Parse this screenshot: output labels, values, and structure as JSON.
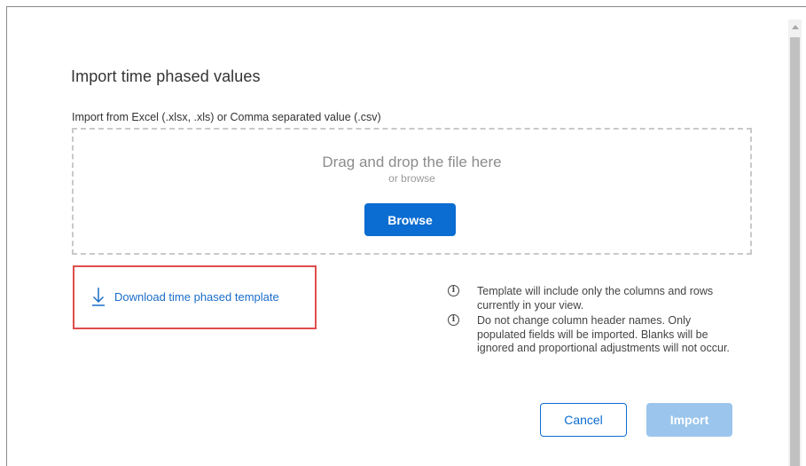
{
  "dialog": {
    "title": "Import time phased values",
    "import_label": "Import from Excel (.xlsx, .xls) or Comma separated value (.csv)"
  },
  "dropzone": {
    "drag_text": "Drag and drop the file here",
    "or_browse": "or browse",
    "browse_label": "Browse"
  },
  "download": {
    "label": "Download time phased template"
  },
  "info": [
    {
      "icon": "info-icon",
      "text": "Template will include only the columns and rows currently in your view."
    },
    {
      "icon": "info-icon",
      "text": "Do not change column header names. Only populated fields will be imported. Blanks will be ignored and proportional adjustments will not occur."
    }
  ],
  "actions": {
    "cancel_label": "Cancel",
    "import_label": "Import"
  },
  "colors": {
    "primary": "#0b6cd1",
    "primary_disabled": "#9bc5ec",
    "highlight": "#e04d4d",
    "link": "#1a6dc8"
  }
}
